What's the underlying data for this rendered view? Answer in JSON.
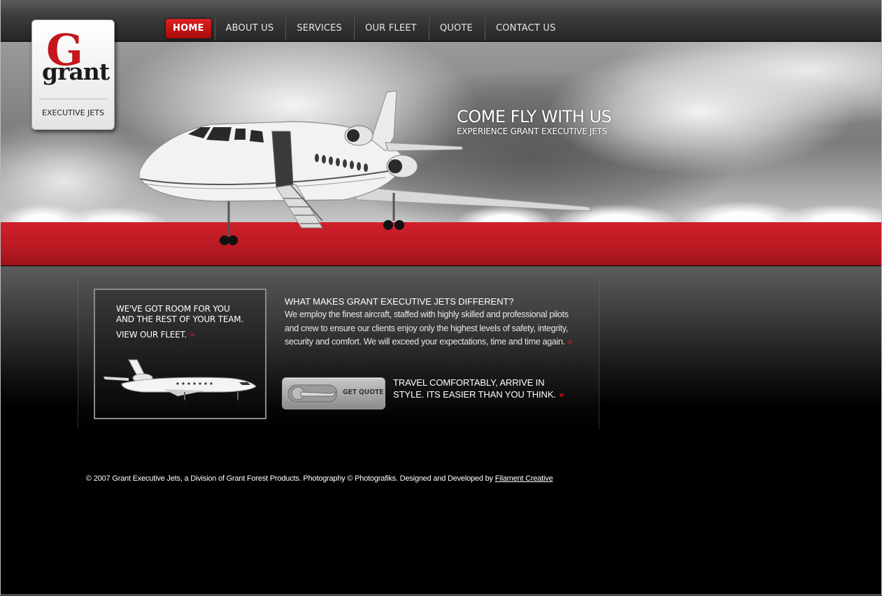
{
  "brand": {
    "logo_initial": "G",
    "logo_word": "grant",
    "tagline": "EXECUTIVE JETS",
    "colors": {
      "accent_red": "#c4161c",
      "nav_dark": "#2e2e2e"
    }
  },
  "nav": {
    "items": [
      {
        "label": "HOME",
        "active": true
      },
      {
        "label": "ABOUT US"
      },
      {
        "label": "SERVICES"
      },
      {
        "label": "OUR FLEET"
      },
      {
        "label": "QUOTE"
      },
      {
        "label": "CONTACT US"
      }
    ]
  },
  "hero": {
    "headline": "COME FLY WITH US",
    "subheadline": "EXPERIENCE GRANT EXECUTIVE JETS"
  },
  "promo": {
    "line1": "WE'VE GOT ROOM FOR YOU",
    "line2": "AND THE REST OF YOUR TEAM.",
    "link_label": "VIEW OUR FLEET.",
    "arrow": "»"
  },
  "about": {
    "title": "WHAT MAKES GRANT EXECUTIVE JETS DIFFERENT?",
    "body": "We employ the finest aircraft, staffed with highly skilled and professional pilots and crew to ensure our clients enjoy only the highest levels of safety, integrity, security and comfort. We will exceed your expectations, time and time again.",
    "arrow": "»"
  },
  "quote": {
    "button_label": "GET QUOTE",
    "tagline": "TRAVEL COMFORTABLY, ARRIVE IN STYLE. ITS EASIER THAN YOU THINK.",
    "arrow": "»"
  },
  "footer": {
    "text": "© 2007 Grant Executive Jets, a Division of Grant Forest Products. Photography © Photografiks. Designed and Developed by",
    "link_label": "Filament Creative"
  }
}
